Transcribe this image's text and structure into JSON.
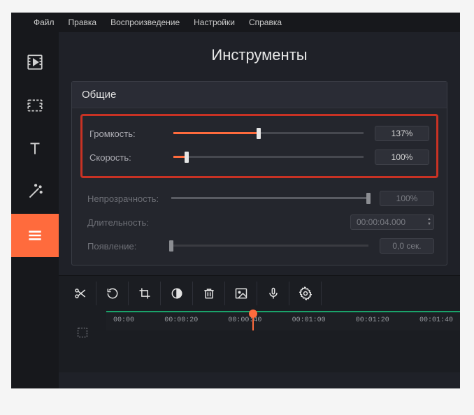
{
  "menu": {
    "file": "Файл",
    "edit": "Правка",
    "playback": "Воспроизведение",
    "settings": "Настройки",
    "help": "Справка"
  },
  "panel": {
    "title": "Инструменты",
    "section": "Общие"
  },
  "rows": {
    "volume": {
      "label": "Громкость:",
      "value": "137%",
      "fill_pct": 45
    },
    "speed": {
      "label": "Скорость:",
      "value": "100%",
      "fill_pct": 7
    },
    "opacity": {
      "label": "Непрозрачность:",
      "value": "100%",
      "fill_pct": 100
    },
    "duration": {
      "label": "Длительность:",
      "value": "00:00:04.000"
    },
    "appearance": {
      "label": "Появление:",
      "value": "0,0 сек.",
      "fill_pct": 0
    }
  },
  "ruler": {
    "ticks": [
      "00:00",
      "00:00:20",
      "00:00:40",
      "00:01:00",
      "00:01:20",
      "00:01:40"
    ]
  },
  "colors": {
    "accent": "#ff6b3d",
    "highlight_border": "#c83224",
    "green": "#1aa36a"
  }
}
